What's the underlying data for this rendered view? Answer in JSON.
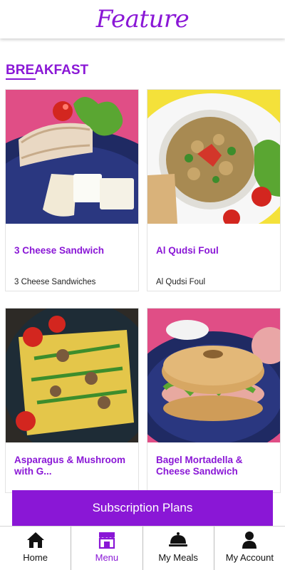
{
  "header": {
    "title": "Feature"
  },
  "section": {
    "title": "BREAKFAST"
  },
  "cards": [
    {
      "name": "3 Cheese Sandwich",
      "description": "3 Cheese Sandwiches"
    },
    {
      "name": "Al Qudsi Foul",
      "description": "Al Qudsi Foul"
    },
    {
      "name": "Asparagus & Mushroom with G...",
      "description": ""
    },
    {
      "name": "Bagel Mortadella & Cheese Sandwich",
      "description": ""
    }
  ],
  "subscription_button": {
    "label": "Subscription Plans"
  },
  "tabs": [
    {
      "label": "Home",
      "icon": "home-icon",
      "active": false
    },
    {
      "label": "Menu",
      "icon": "menu-shop-icon",
      "active": true
    },
    {
      "label": "My Meals",
      "icon": "cloche-icon",
      "active": false
    },
    {
      "label": "My Account",
      "icon": "user-icon",
      "active": false
    }
  ],
  "colors": {
    "accent": "#8a17d6",
    "background": "#ffffff"
  }
}
